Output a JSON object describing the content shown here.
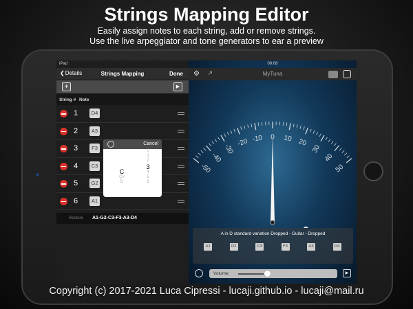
{
  "header": {
    "title": "Strings Mapping Editor",
    "subtitle_line1": "Easily assign notes to each string, add or remove strings.",
    "subtitle_line2": "Use the live arpeggiator and tone generators to ear a preview"
  },
  "left_pane": {
    "status_device": "iPad",
    "back_label": "Details",
    "nav_title": "Strings Mapping",
    "done_label": "Done",
    "col_string": "String #",
    "col_note": "Note",
    "strings": [
      {
        "num": "1",
        "note": "D4"
      },
      {
        "num": "2",
        "note": "A3"
      },
      {
        "num": "3",
        "note": "F3"
      },
      {
        "num": "4",
        "note": "C3"
      },
      {
        "num": "5",
        "note": "G2"
      },
      {
        "num": "6",
        "note": "A1"
      }
    ],
    "restore_label": "Restore",
    "restore_value": "A1-G2-C3-F3-A3-D4"
  },
  "picker": {
    "cancel_label": "Cancel",
    "note_options": [
      "",
      "",
      "",
      "",
      "C",
      "C#",
      "D"
    ],
    "note_selected": "C",
    "octave_options": [
      "0",
      "1",
      "2",
      "3",
      "4",
      "5",
      "6"
    ],
    "octave_selected": "3"
  },
  "right_pane": {
    "status_time": "00:08",
    "nav_title": "MyTuna",
    "gauge_ticks": [
      "-50",
      "-40",
      "-30",
      "-20",
      "-10",
      "0",
      "10",
      "20",
      "30",
      "40",
      "50"
    ],
    "needle_cents": 0,
    "tuning_name": "A in D standard variation Dropped - Guitar - Dropped",
    "tuning_notes": [
      "A1",
      "G2",
      "C3",
      "F3",
      "A3",
      "D4"
    ],
    "volume_label": "Volume:",
    "volume_level": 0.4
  },
  "footer": {
    "copyright": "Copyright (c) 2017-2021 Luca Cipressi - lucaji.github.io - lucaji@mail.ru"
  }
}
